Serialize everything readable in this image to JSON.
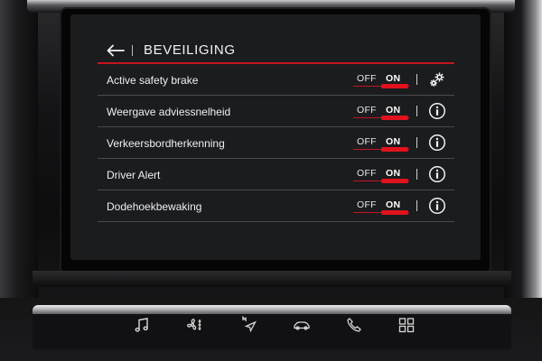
{
  "header": {
    "title": "BEVEILIGING",
    "back_icon": "back-arrow-icon"
  },
  "settings": [
    {
      "label": "Active safety brake",
      "off_label": "OFF",
      "on_label": "ON",
      "state": "on",
      "action_icon": "gear-icon"
    },
    {
      "label": "Weergave adviessnelheid",
      "off_label": "OFF",
      "on_label": "ON",
      "state": "on",
      "action_icon": "info-icon"
    },
    {
      "label": "Verkeersbordherkenning",
      "off_label": "OFF",
      "on_label": "ON",
      "state": "on",
      "action_icon": "info-icon"
    },
    {
      "label": "Driver Alert",
      "off_label": "OFF",
      "on_label": "ON",
      "state": "on",
      "action_icon": "info-icon"
    },
    {
      "label": "Dodehoekbewaking",
      "off_label": "OFF",
      "on_label": "ON",
      "state": "on",
      "action_icon": "info-icon"
    }
  ],
  "touchbar": {
    "icons": [
      "music-icon",
      "fan-icon",
      "navigation-icon",
      "car-icon",
      "phone-icon",
      "apps-grid-icon"
    ]
  },
  "colors": {
    "accent": "#e1121d",
    "screen_bg": "#1b1c1e",
    "text": "#f0f0f0"
  }
}
